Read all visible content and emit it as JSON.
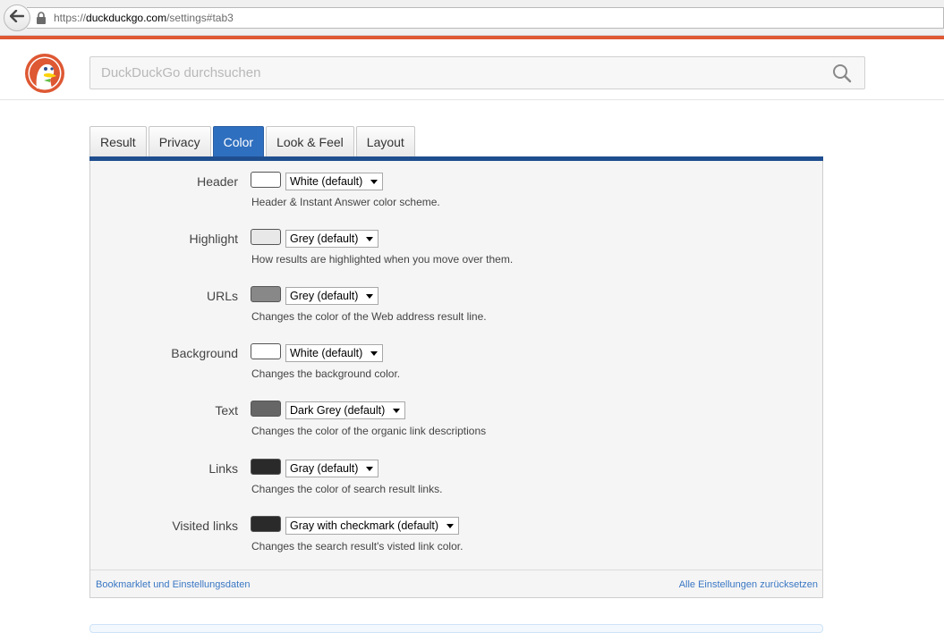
{
  "browser": {
    "url_proto": "https://",
    "url_host": "duckduckgo.com",
    "url_path": "/settings#tab3"
  },
  "search": {
    "placeholder": "DuckDuckGo durchsuchen",
    "value": ""
  },
  "tabs": [
    {
      "label": "Result",
      "active": false
    },
    {
      "label": "Privacy",
      "active": false
    },
    {
      "label": "Color",
      "active": true
    },
    {
      "label": "Look & Feel",
      "active": false
    },
    {
      "label": "Layout",
      "active": false
    }
  ],
  "settings": [
    {
      "label": "Header",
      "swatch_color": "#ffffff",
      "selected": "White (default)",
      "description": "Header & Instant Answer color scheme."
    },
    {
      "label": "Highlight",
      "swatch_color": "#e8e8e8",
      "selected": "Grey (default)",
      "description": "How results are highlighted when you move over them."
    },
    {
      "label": "URLs",
      "swatch_color": "#888888",
      "selected": "Grey (default)",
      "description": "Changes the color of the Web address result line."
    },
    {
      "label": "Background",
      "swatch_color": "#ffffff",
      "selected": "White (default)",
      "description": "Changes the background color."
    },
    {
      "label": "Text",
      "swatch_color": "#666666",
      "selected": "Dark Grey (default)",
      "description": "Changes the color of the organic link descriptions"
    },
    {
      "label": "Links",
      "swatch_color": "#2a2a2a",
      "selected": "Gray (default)",
      "description": "Changes the color of search result links."
    },
    {
      "label": "Visited links",
      "swatch_color": "#2a2a2a",
      "selected": "Gray with checkmark (default)",
      "description": "Changes the search result's visted link color."
    }
  ],
  "footer": {
    "left_link": "Bookmarklet und Einstellungsdaten",
    "right_link": "Alle Einstellungen zurücksetzen"
  },
  "colors": {
    "accent": "#de5833",
    "tab_active": "#2f6fbf",
    "tab_strip": "#1f4e8f",
    "link": "#3a77c4"
  }
}
